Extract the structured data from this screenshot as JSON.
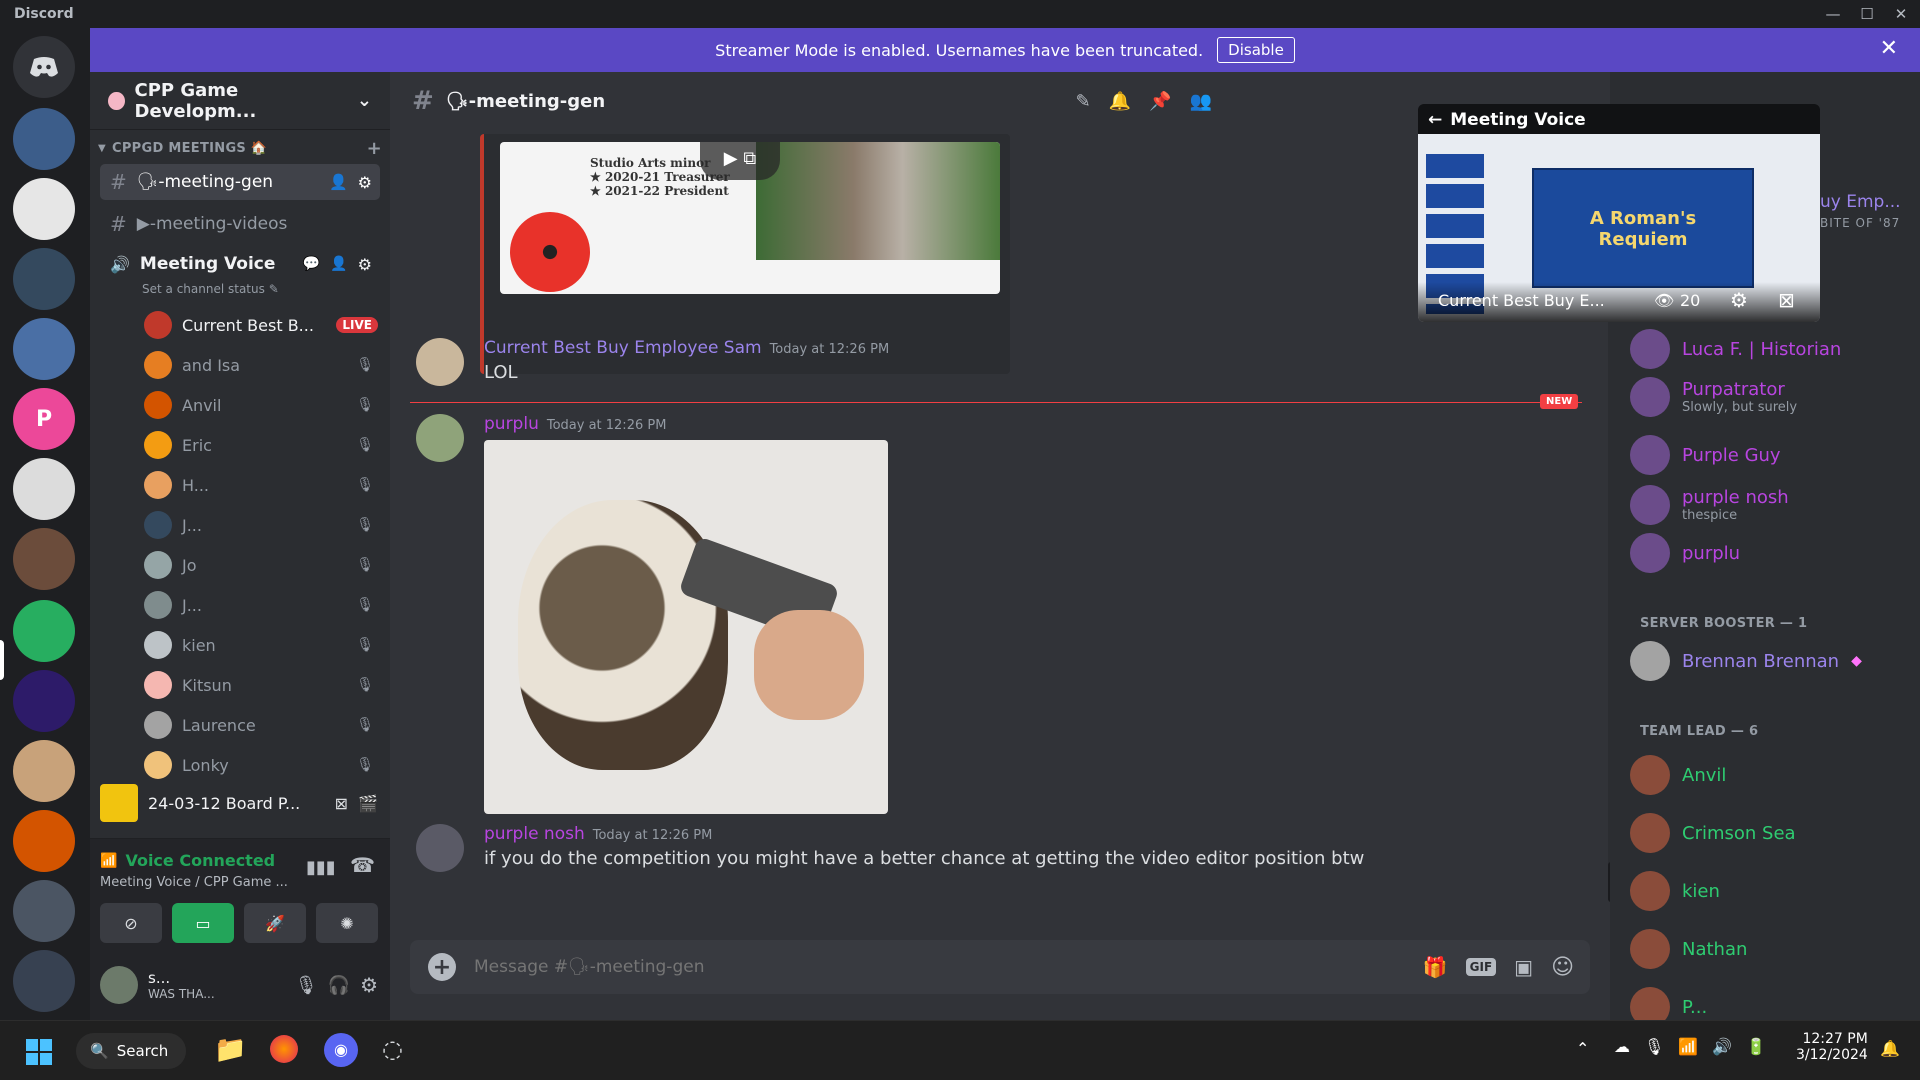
{
  "window": {
    "app_title": "Discord",
    "minimize": "—",
    "maximize": "☐",
    "close": "✕"
  },
  "banner": {
    "message": "Streamer Mode is enabled. Usernames have been truncated.",
    "button": "Disable",
    "close": "✕"
  },
  "guild": {
    "name": "CPP Game Developm...",
    "chevron": "⌄"
  },
  "category": {
    "label": "CPPGD MEETINGS 🏠",
    "add": "+"
  },
  "channels": {
    "meeting_gen": "-meeting-gen",
    "meeting_videos": "-meeting-videos",
    "meeting_voice": "Meeting Voice",
    "voice_status": "Set a channel status"
  },
  "voice_users": [
    {
      "name": "Current Best B...",
      "badge": "LIVE",
      "color": "#c0392b"
    },
    {
      "name": "and Isa",
      "color": "#e67e22"
    },
    {
      "name": "Anvil",
      "color": "#d35400"
    },
    {
      "name": "Eric",
      "color": "#f39c12"
    },
    {
      "name": "H...",
      "color": "#e8a060"
    },
    {
      "name": "J...",
      "color": "#34495e"
    },
    {
      "name": "Jo",
      "color": "#95a5a6"
    },
    {
      "name": "J...",
      "color": "#7f8c8d"
    },
    {
      "name": "kien",
      "color": "#bdc3c7"
    },
    {
      "name": "Kitsun",
      "color": "#f5b7b1"
    },
    {
      "name": "Laurence",
      "color": "#a3a3a3"
    },
    {
      "name": "Lonky",
      "color": "#f0c27b"
    }
  ],
  "activity": {
    "title": "24-03-12 Board P..."
  },
  "voice_panel": {
    "status": "Voice Connected",
    "location": "Meeting Voice / CPP Game ..."
  },
  "user_panel": {
    "name": "s...",
    "status": "WAS THA..."
  },
  "chat": {
    "channel_title": "-meeting-gen",
    "embed_lines": [
      "Studio Arts minor",
      "2020-21 Treasurer",
      "2021-22 President"
    ],
    "new_label": "NEW",
    "messages": [
      {
        "author": "Current Best Buy Employee Sam",
        "time": "Today at 12:26 PM",
        "text": "LOL",
        "color": "#9b84ec"
      },
      {
        "author": "purplu",
        "time": "Today at 12:26 PM",
        "text": "",
        "color": "#b845e0"
      },
      {
        "author": "purple nosh",
        "time": "Today at 12:26 PM",
        "text": "if you do the competition you might have a better chance at getting the video editor position btw",
        "color": "#b845e0"
      }
    ],
    "composer_placeholder": "Message #🗣-meeting-gen",
    "gif_label": "GIF"
  },
  "popout": {
    "title": "Meeting Voice",
    "slide_title_1": "A Roman's",
    "slide_title_2": "Requiem",
    "streamer": "Current Best Buy E...",
    "viewers": "20"
  },
  "members": {
    "partial_name": "uy Emp...",
    "partial_sub": "BITE OF '87",
    "top": [
      {
        "name": "Luca F. | Historian",
        "color": "#b845e0"
      },
      {
        "name": "Purpatrator",
        "sub": "Slowly, but surely",
        "color": "#b845e0"
      },
      {
        "name": "Purple Guy",
        "color": "#b845e0"
      },
      {
        "name": "purple nosh",
        "sub": "thespice",
        "color": "#b845e0"
      },
      {
        "name": "purplu",
        "color": "#b845e0"
      }
    ],
    "booster_header": "SERVER BOOSTER — 1",
    "booster": {
      "name": "Brennan Brennan",
      "color": "#9b84ec"
    },
    "lead_header": "TEAM LEAD — 6",
    "leads": [
      {
        "name": "Anvil",
        "color": "#2ecc71"
      },
      {
        "name": "Crimson Sea",
        "color": "#2ecc71"
      },
      {
        "name": "kien",
        "color": "#2ecc71"
      },
      {
        "name": "Nathan",
        "color": "#2ecc71"
      },
      {
        "name": "P...",
        "color": "#2ecc71"
      }
    ]
  },
  "taskbar": {
    "search": "Search",
    "time": "12:27 PM",
    "date": "3/12/2024"
  }
}
